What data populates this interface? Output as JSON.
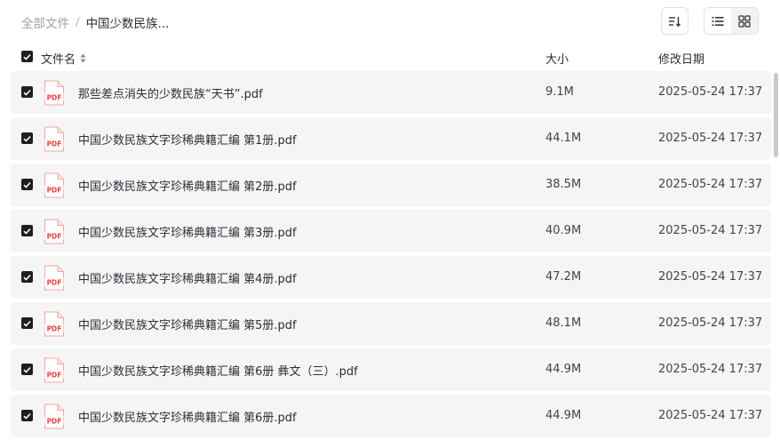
{
  "breadcrumb": {
    "root": "全部文件",
    "separator": "/",
    "current": "中国少数民族..."
  },
  "toolbar": {
    "sort_icon": "sort-icon",
    "list_view_icon": "list-view-icon",
    "grid_view_icon": "grid-view-icon"
  },
  "table": {
    "headers": {
      "name": "文件名",
      "size": "大小",
      "modified": "修改日期"
    },
    "rows": [
      {
        "name": "那些差点消失的少数民族“天书”.pdf",
        "size": "9.1M",
        "date": "2025-05-24 17:37",
        "icon": "pdf-file-icon",
        "checked": true
      },
      {
        "name": "中国少数民族文字珍稀典籍汇编 第1册.pdf",
        "size": "44.1M",
        "date": "2025-05-24 17:37",
        "icon": "pdf-file-icon",
        "checked": true
      },
      {
        "name": "中国少数民族文字珍稀典籍汇编 第2册.pdf",
        "size": "38.5M",
        "date": "2025-05-24 17:37",
        "icon": "pdf-file-icon",
        "checked": true
      },
      {
        "name": "中国少数民族文字珍稀典籍汇编 第3册.pdf",
        "size": "40.9M",
        "date": "2025-05-24 17:37",
        "icon": "pdf-file-icon",
        "checked": true
      },
      {
        "name": "中国少数民族文字珍稀典籍汇编 第4册.pdf",
        "size": "47.2M",
        "date": "2025-05-24 17:37",
        "icon": "pdf-file-icon",
        "checked": true
      },
      {
        "name": "中国少数民族文字珍稀典籍汇编 第5册.pdf",
        "size": "48.1M",
        "date": "2025-05-24 17:37",
        "icon": "pdf-file-icon",
        "checked": true
      },
      {
        "name": "中国少数民族文字珍稀典籍汇编 第6册 彝文（三）.pdf",
        "size": "44.9M",
        "date": "2025-05-24 17:37",
        "icon": "pdf-file-icon",
        "checked": true
      },
      {
        "name": "中国少数民族文字珍稀典籍汇编 第6册.pdf",
        "size": "44.9M",
        "date": "2025-05-24 17:37",
        "icon": "pdf-file-icon",
        "checked": true
      }
    ]
  },
  "pdf_label": "PDF",
  "colors": {
    "pdf_red": "#e8413b",
    "row_bg": "#f5f5f6",
    "checkbox": "#1f1f1f"
  }
}
